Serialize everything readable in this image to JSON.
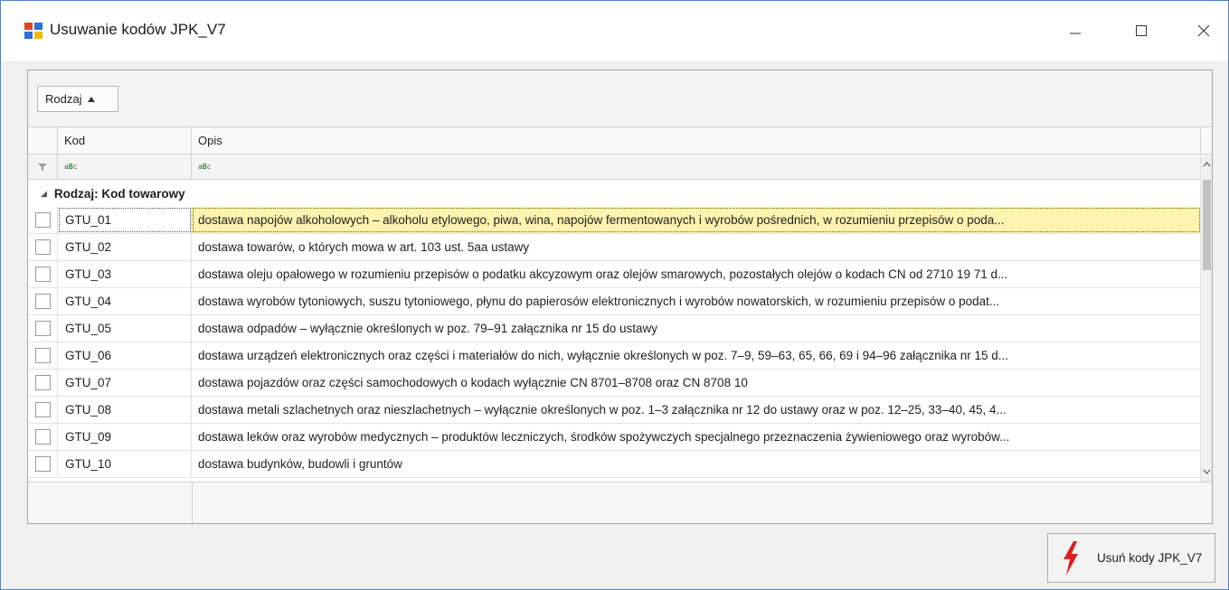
{
  "window": {
    "title": "Usuwanie kodów JPK_V7",
    "controls": [
      "minimize",
      "maximize",
      "close"
    ]
  },
  "grid": {
    "group_chip_label": "Rodzaj",
    "columns": [
      "Kod",
      "Opis"
    ],
    "group_header": "Rodzaj: Kod towarowy",
    "rows": [
      {
        "kod": "GTU_01",
        "opis": "dostawa napojów alkoholowych – alkoholu etylowego, piwa, wina, napojów fermentowanych i wyrobów pośrednich, w rozumieniu przepisów o poda...",
        "checked": false,
        "focused": true
      },
      {
        "kod": "GTU_02",
        "opis": "dostawa towarów, o których mowa w art. 103 ust. 5aa ustawy",
        "checked": false
      },
      {
        "kod": "GTU_03",
        "opis": "dostawa oleju opałowego w rozumieniu przepisów o podatku akcyzowym oraz olejów smarowych, pozostałych olejów o kodach CN od 2710 19 71 d...",
        "checked": false
      },
      {
        "kod": "GTU_04",
        "opis": "dostawa wyrobów tytoniowych, suszu tytoniowego, płynu do papierosów elektronicznych i wyrobów nowatorskich, w rozumieniu przepisów o podat...",
        "checked": false
      },
      {
        "kod": "GTU_05",
        "opis": "dostawa odpadów – wyłącznie określonych w poz. 79–91 załącznika nr 15 do ustawy",
        "checked": false
      },
      {
        "kod": "GTU_06",
        "opis": "dostawa urządzeń elektronicznych oraz części i materiałów do nich, wyłącznie określonych w poz. 7–9, 59–63, 65, 66, 69 i 94–96 załącznika nr 15 d...",
        "checked": false
      },
      {
        "kod": "GTU_07",
        "opis": "dostawa pojazdów oraz części samochodowych o kodach wyłącznie CN 8701–8708 oraz CN 8708 10",
        "checked": false
      },
      {
        "kod": "GTU_08",
        "opis": "dostawa metali szlachetnych oraz nieszlachetnych – wyłącznie określonych w poz. 1–3 załącznika nr 12 do ustawy oraz w poz. 12–25, 33–40, 45, 4...",
        "checked": false
      },
      {
        "kod": "GTU_09",
        "opis": "dostawa leków oraz wyrobów medycznych – produktów leczniczych, środków spożywczych specjalnego przeznaczenia żywieniowego oraz wyrobów...",
        "checked": false
      },
      {
        "kod": "GTU_10",
        "opis": "dostawa budynków, budowli i gruntów",
        "checked": false
      }
    ]
  },
  "actions": {
    "delete_label": "Usuń kody JPK_V7"
  }
}
